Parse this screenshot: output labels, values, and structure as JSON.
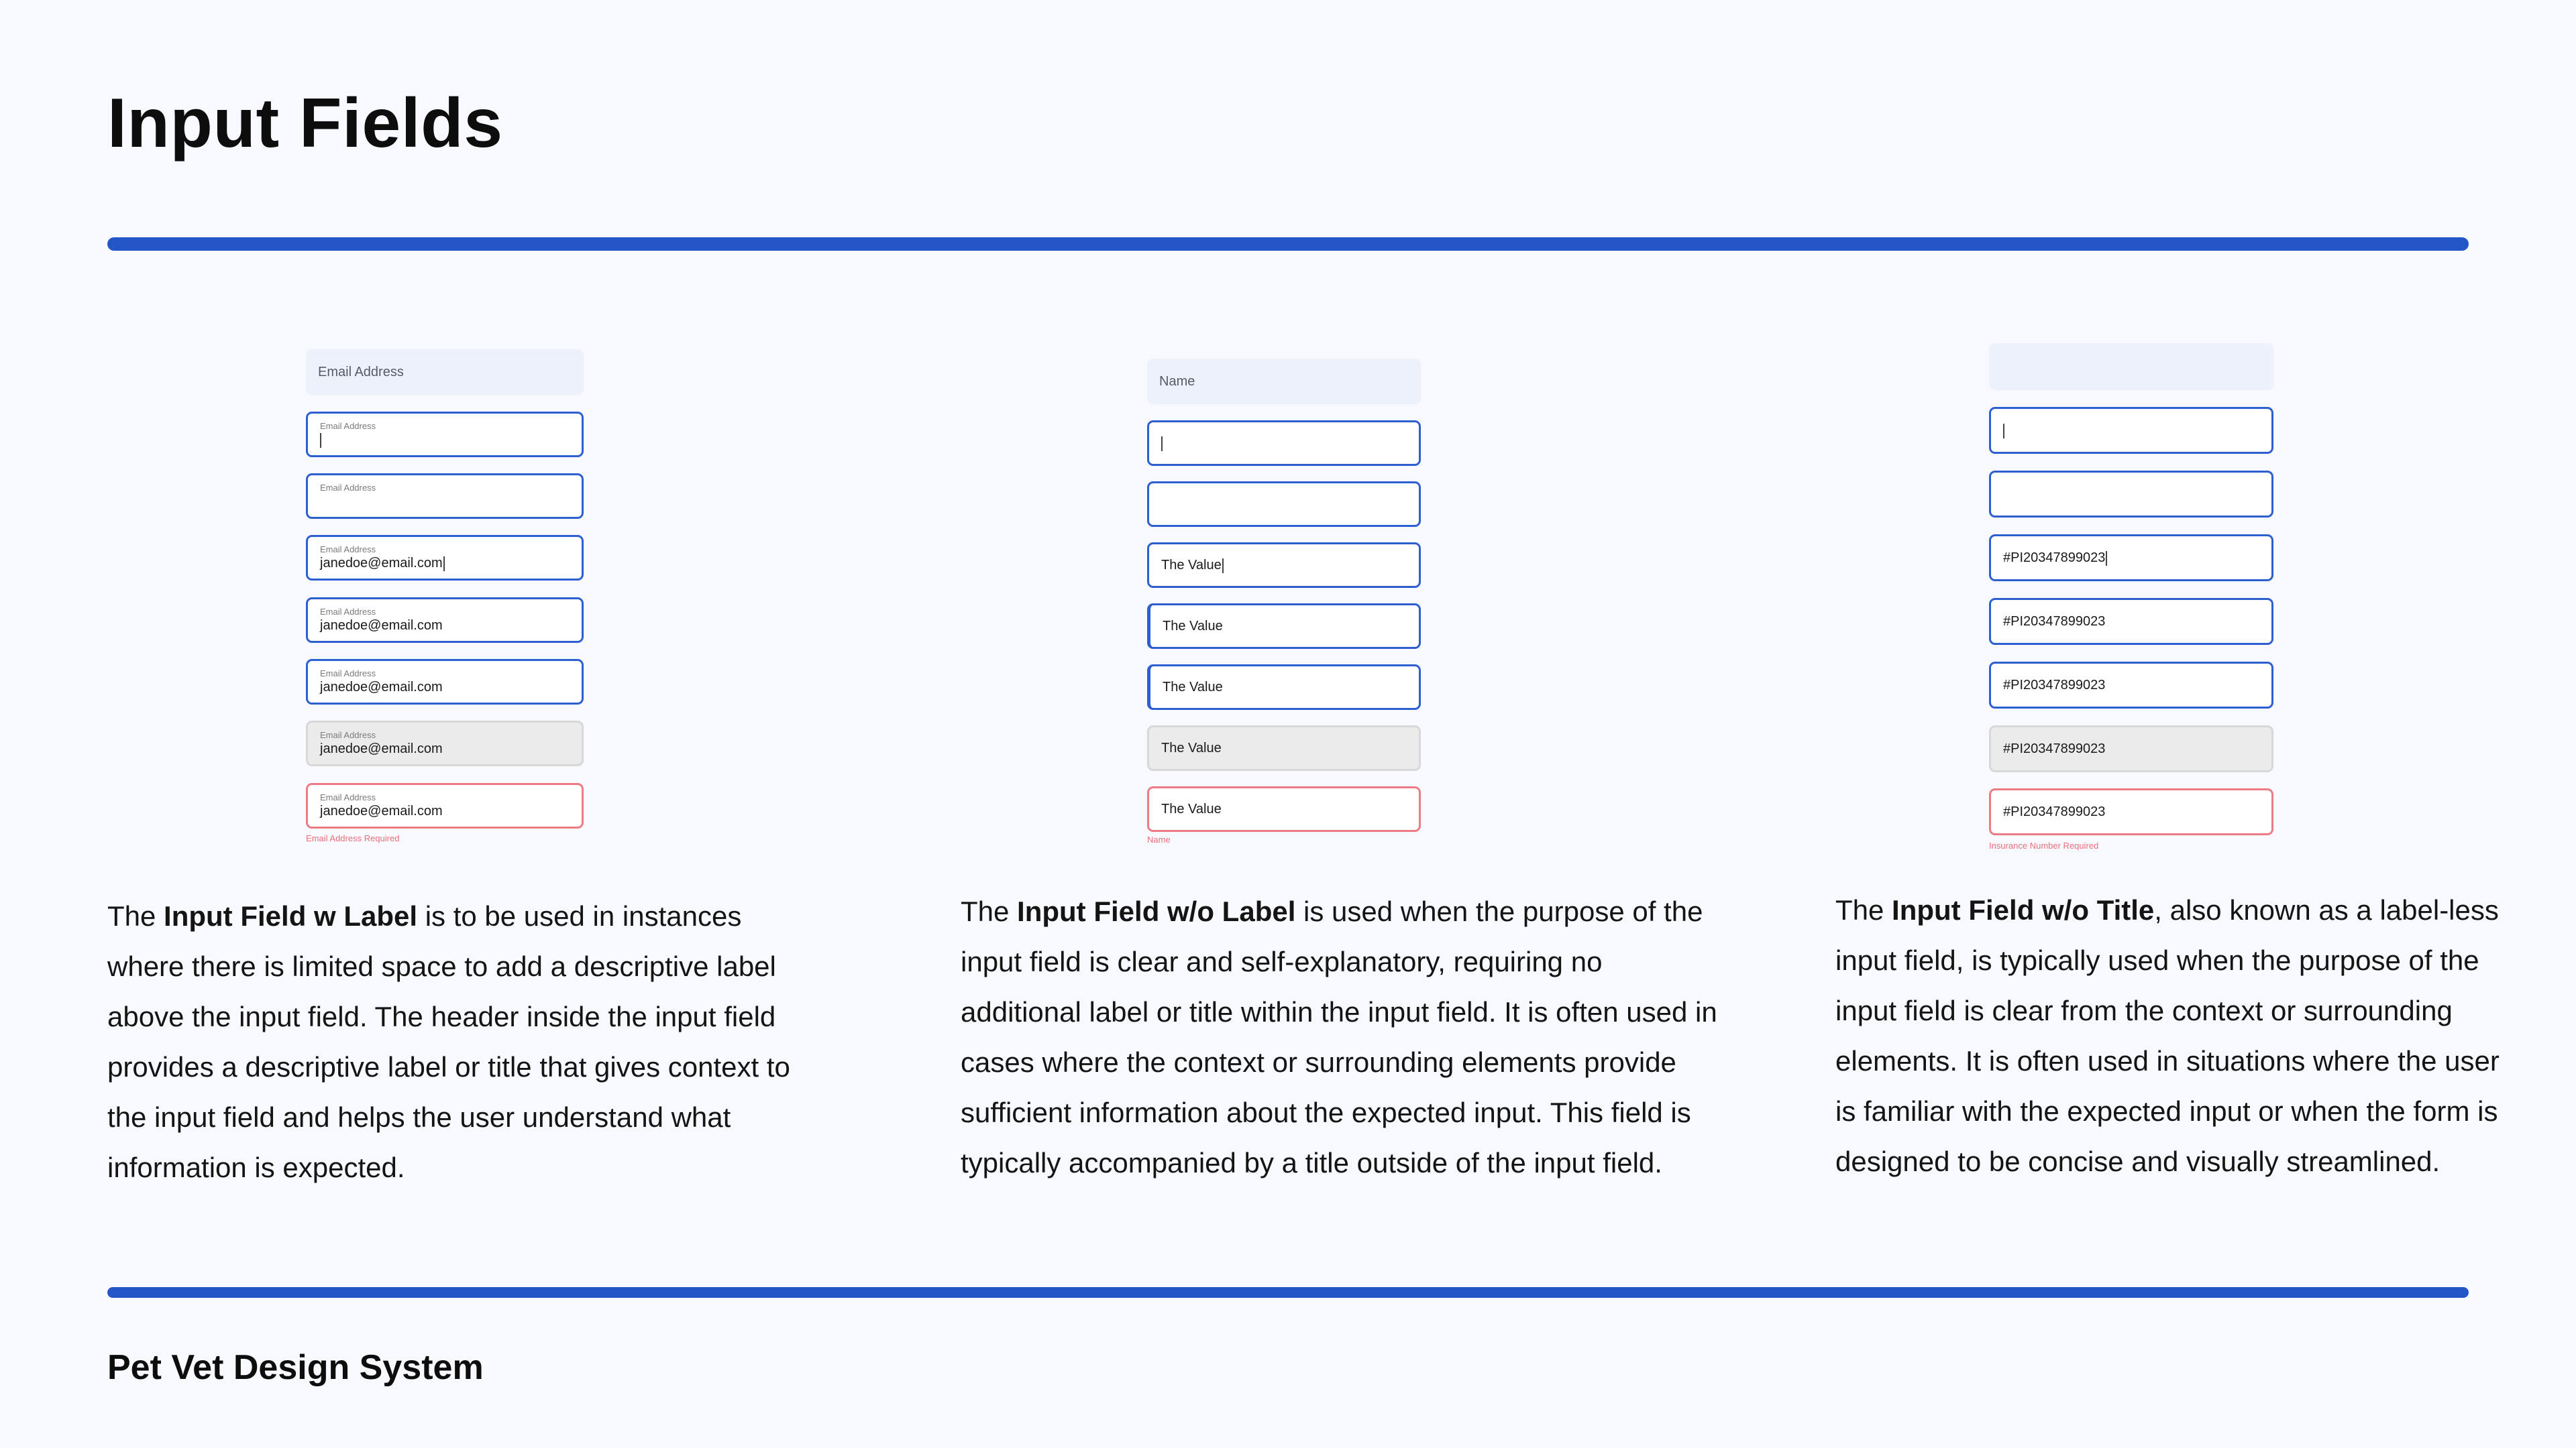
{
  "page": {
    "title": "Input Fields",
    "footer": "Pet Vet Design System",
    "accent_color": "#2556c7",
    "error_color": "#ec7b84"
  },
  "col1": {
    "header": "Email Address",
    "label": "Email Address",
    "value": "janedoe@email.com",
    "error": "Email Address Required",
    "desc_pre": "The ",
    "desc_bold": "Input Field w Label",
    "desc_post": " is to be used in instances where there is limited space to add a descriptive label above the input field. The header inside the input field provides a descriptive label or title that gives context to the input field and helps the user understand what information is expected."
  },
  "col2": {
    "header": "Name",
    "value": "The Value",
    "error": "Name",
    "desc_pre": "The ",
    "desc_bold": "Input Field w/o Label",
    "desc_post": " is used when the purpose of the input field is clear and self-explanatory, requiring no additional label or title within the input field. It is often used in cases where the context or surrounding elements provide sufficient information about the expected input. This field is typically accompanied by a title outside of the input field."
  },
  "col3": {
    "header": "",
    "value": "#PI20347899023",
    "error": "Insurance Number Required",
    "desc_pre": "The ",
    "desc_bold": "Input Field w/o Title",
    "desc_post": ", also known as a label-less input field, is typically used when the purpose of the input field is clear from the context or surrounding elements. It is often used in situations where the user is familiar with the expected input or when the form is designed to be concise and visually streamlined."
  }
}
